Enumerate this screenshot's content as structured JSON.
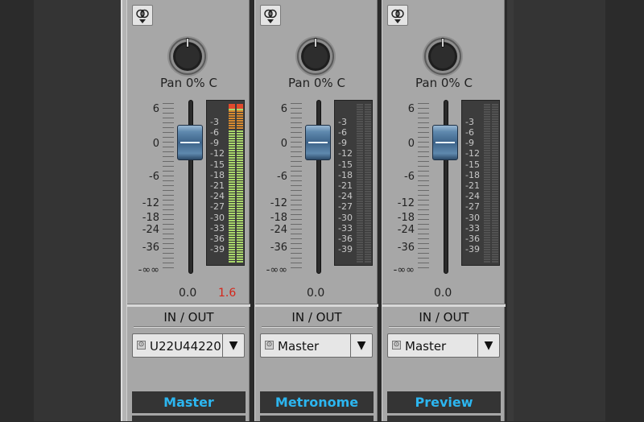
{
  "colors": {
    "accent_name": "#2cb6f0",
    "fader_blue": "#3d6389",
    "meter_green": "#a9d86a",
    "meter_orange": "#d88a2e",
    "clip_red": "#e04a2c",
    "peak_red": "#d4261a"
  },
  "fader_scale": [
    "6",
    "0",
    "-6",
    "-12",
    "-18",
    "-24",
    "-36",
    "-∞∞"
  ],
  "meter_scale": [
    "-3",
    "-6",
    "-9",
    "-12",
    "-15",
    "-18",
    "-21",
    "-24",
    "-27",
    "-30",
    "-33",
    "-36",
    "-39"
  ],
  "io_label": "IN / OUT",
  "icons": {
    "phase": "phase-invert-icon",
    "select_dot": "output-port-icon",
    "select_arrow": "▼"
  },
  "channels": [
    {
      "name": "Master",
      "pan": "Pan 0% C",
      "volume_db": "0.0",
      "peak_db": "1.6",
      "output": "U22U44220",
      "meter_level_left": 1.0,
      "meter_level_right": 1.0,
      "clipping": true
    },
    {
      "name": "Metronome",
      "pan": "Pan 0% C",
      "volume_db": "0.0",
      "peak_db": "",
      "output": "Master",
      "meter_level_left": 0,
      "meter_level_right": 0,
      "clipping": false
    },
    {
      "name": "Preview",
      "pan": "Pan 0% C",
      "volume_db": "0.0",
      "peak_db": "",
      "output": "Master",
      "meter_level_left": 0,
      "meter_level_right": 0,
      "clipping": false
    }
  ]
}
